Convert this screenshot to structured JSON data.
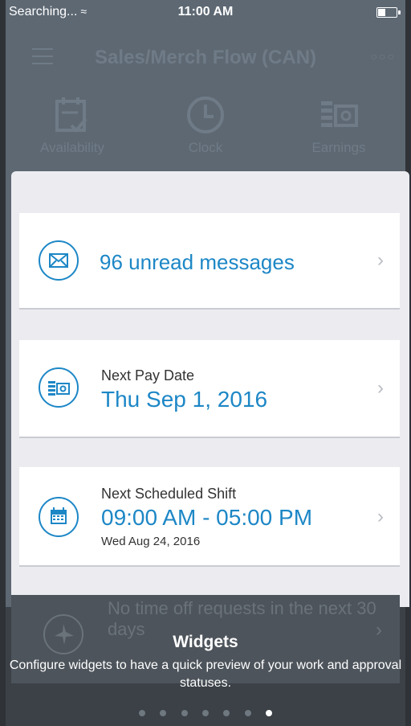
{
  "status": {
    "carrier": "Searching...",
    "time": "11:00 AM"
  },
  "nav": {
    "title": "Sales/Merch Flow (CAN)"
  },
  "tabs": [
    {
      "label": "Availability"
    },
    {
      "label": "Clock"
    },
    {
      "label": "Earnings"
    }
  ],
  "widgets": {
    "messages": {
      "text": "96 unread messages"
    },
    "pay": {
      "label": "Next Pay Date",
      "value": "Thu Sep 1, 2016"
    },
    "shift": {
      "label": "Next Scheduled Shift",
      "value": "09:00 AM - 05:00 PM",
      "date": "Wed Aug 24, 2016"
    },
    "timeoff": {
      "text": "No time off requests in the next 30 days"
    }
  },
  "tutorial": {
    "title": "Widgets",
    "description": "Configure widgets to have a quick preview of your work and approval statuses.",
    "page_count": 7,
    "active_page": 7
  },
  "colors": {
    "accent": "#1d87c6",
    "header_bg": "#5d6873",
    "footer_bg": "#3b4147"
  }
}
